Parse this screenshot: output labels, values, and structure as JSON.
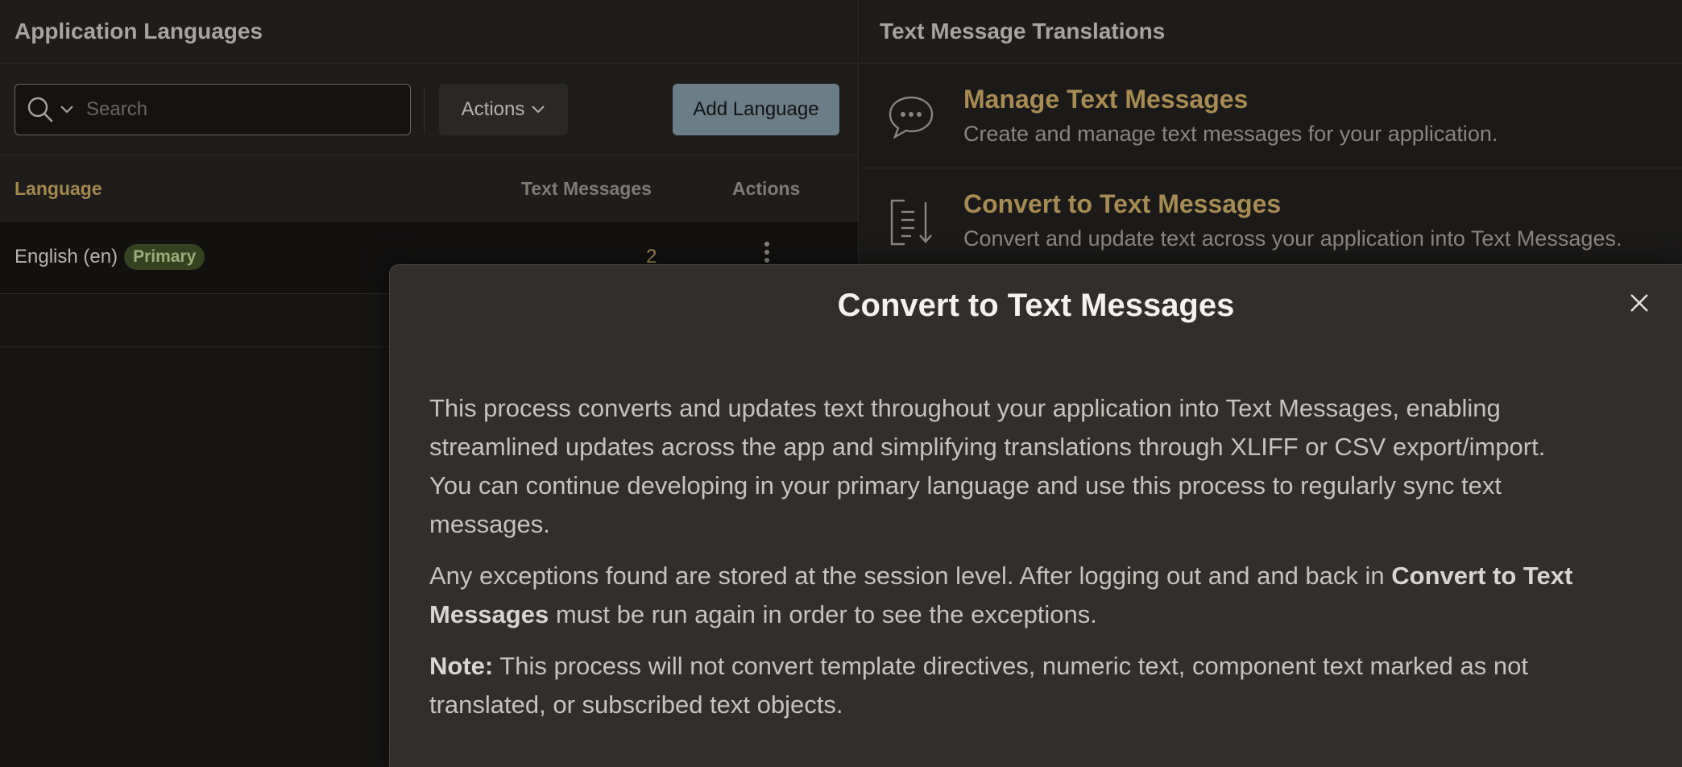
{
  "left_panel": {
    "title": "Application Languages",
    "search": {
      "placeholder": "Search"
    },
    "actions_label": "Actions",
    "add_language_label": "Add Language",
    "table": {
      "columns": [
        "Language",
        "Text Messages",
        "Actions"
      ],
      "rows": [
        {
          "language": "English (en)",
          "badge": "Primary",
          "text_messages": "2"
        }
      ]
    }
  },
  "right_panel": {
    "title": "Text Message Translations",
    "links": [
      {
        "title": "Manage Text Messages",
        "description": "Create and manage text messages for your application.",
        "icon": "speech-bubble-icon"
      },
      {
        "title": "Convert to Text Messages",
        "description": "Convert and update text across your application into Text Messages.",
        "icon": "convert-list-icon"
      }
    ]
  },
  "modal": {
    "title": "Convert to Text Messages",
    "p1": "This process converts and updates text throughout your application into Text Messages, enabling streamlined updates across the app and simplifying translations through XLIFF or CSV export/import. You can continue developing in your primary language and use this process to regularly sync text messages.",
    "p2_start": "Any exceptions found are stored at the session level. After logging out and and back in ",
    "p2_bold": "Convert to Text Messages",
    "p2_end": " must be run again in order to see the exceptions.",
    "p3_bold": "Note:",
    "p3_text": " This process will not convert template directives, numeric text, component text marked as not translated, or subscribed text objects."
  },
  "colors": {
    "accent_gold": "#a68b52",
    "primary_badge_bg": "#34421f",
    "add_button_bg": "#6b7d86",
    "modal_bg": "#312e2c"
  }
}
